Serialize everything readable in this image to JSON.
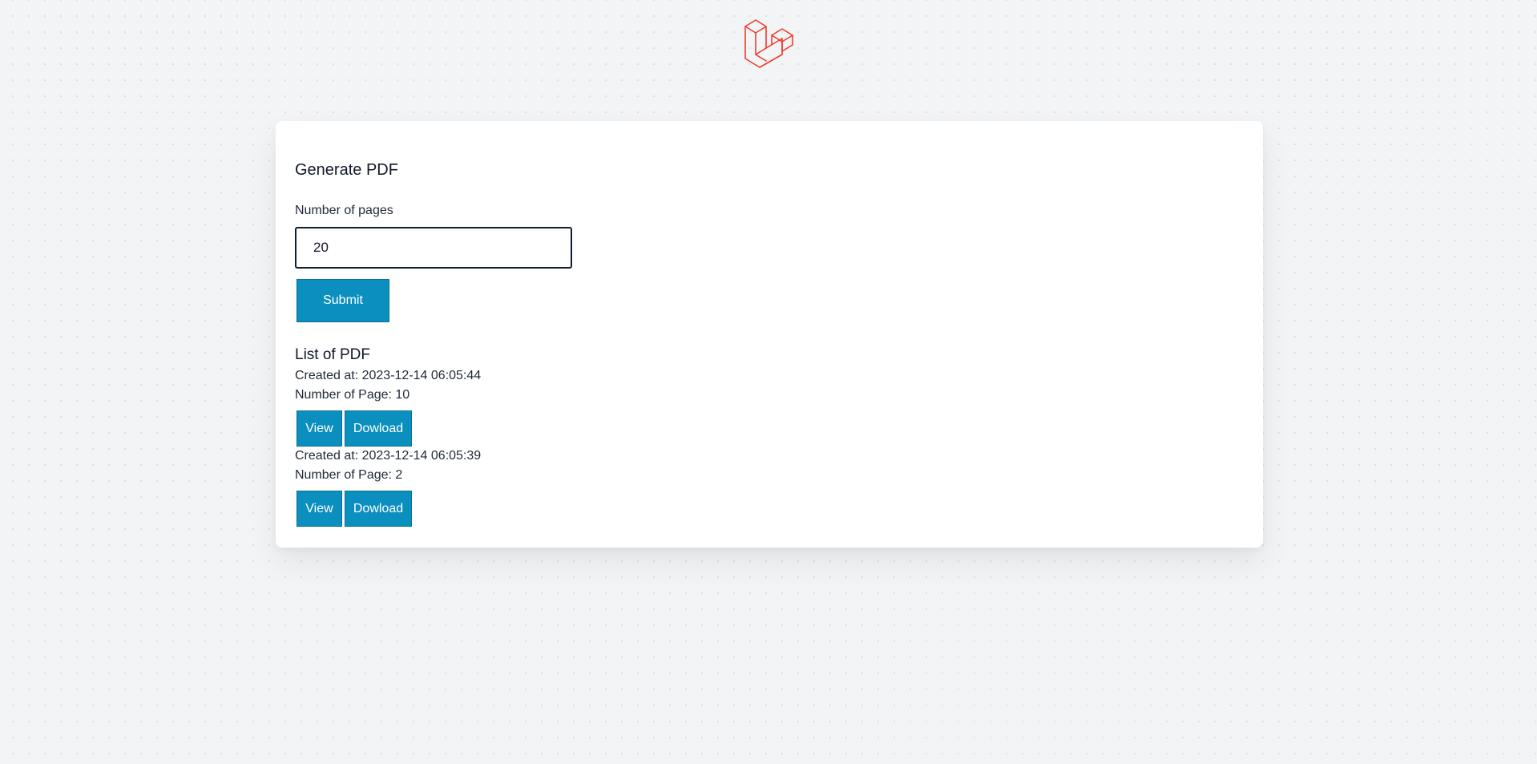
{
  "brand": {
    "logo_icon": "laravel-logo-icon",
    "accent": "#ef3b2d"
  },
  "form": {
    "title": "Generate PDF",
    "pages_label": "Number of pages",
    "pages_value": "20",
    "submit_label": "Submit"
  },
  "list": {
    "title": "List of PDF",
    "items": [
      {
        "created": "Created at: 2023-12-14 06:05:44",
        "pages": "Number of Page: 10",
        "view_label": "View",
        "download_label": "Dowload"
      },
      {
        "created": "Created at: 2023-12-14 06:05:39",
        "pages": "Number of Page: 2",
        "view_label": "View",
        "download_label": "Dowload"
      }
    ]
  },
  "colors": {
    "button": "#0b8fbf",
    "page_background": "#f3f4f6",
    "card": "#ffffff"
  }
}
